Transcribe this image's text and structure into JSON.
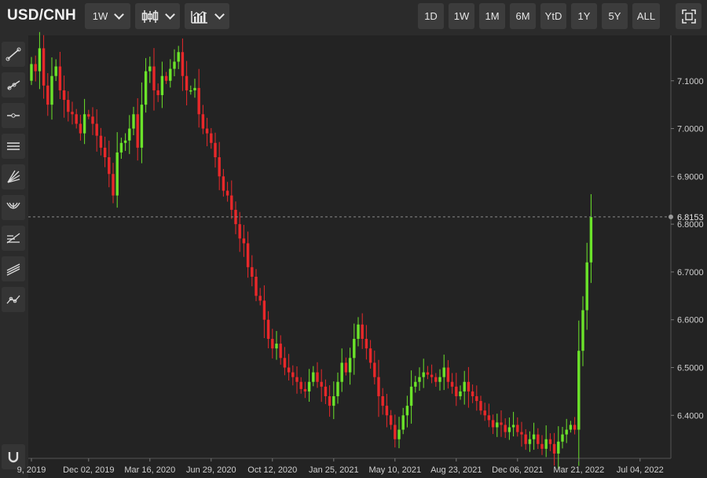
{
  "header": {
    "pair": "USD/CNH",
    "interval_label": "1W",
    "chart_type_icon": "candlestick-icon",
    "indicator_icon": "bar-chart-icon",
    "ranges": [
      "1D",
      "1W",
      "1M",
      "6M",
      "YtD",
      "1Y",
      "5Y",
      "ALL"
    ],
    "fullscreen_icon": "fullscreen-icon"
  },
  "sidebar": {
    "tools": [
      {
        "name": "trend-line-tool",
        "icon": "line-icon"
      },
      {
        "name": "ray-tool",
        "icon": "ray-icon"
      },
      {
        "name": "horizontal-line-tool",
        "icon": "horizontal-line-icon"
      },
      {
        "name": "channel-tool",
        "icon": "channel-icon"
      },
      {
        "name": "fan-tool",
        "icon": "fan-icon"
      },
      {
        "name": "pitchfork-tool",
        "icon": "pitchfork-icon"
      },
      {
        "name": "fibonacci-tool",
        "icon": "fib-icon"
      },
      {
        "name": "parallel-lines-tool",
        "icon": "parallel-icon"
      },
      {
        "name": "path-tool",
        "icon": "path-icon"
      }
    ],
    "magnet_icon": "magnet-icon"
  },
  "colors": {
    "up": "#6be32a",
    "down": "#e8282a",
    "background": "#232323",
    "grid": "#333333",
    "label": "#cfcfcf"
  },
  "chart_data": {
    "type": "candlestick",
    "title": "",
    "last_price": 6.8153,
    "ylim": [
      6.31,
      7.195
    ],
    "y_ticks": [
      "6.4000",
      "6.5000",
      "6.6000",
      "6.7000",
      "6.8000",
      "6.9000",
      "7.0000",
      "7.1000"
    ],
    "x_ticks": [
      {
        "index": 0,
        "label": "9, 2019"
      },
      {
        "index": 14,
        "label": "Dec 02, 2019"
      },
      {
        "index": 29,
        "label": "Mar 16, 2020"
      },
      {
        "index": 44,
        "label": "Jun 29, 2020"
      },
      {
        "index": 59,
        "label": "Oct 12, 2020"
      },
      {
        "index": 74,
        "label": "Jan 25, 2021"
      },
      {
        "index": 89,
        "label": "May 10, 2021"
      },
      {
        "index": 104,
        "label": "Aug 23, 2021"
      },
      {
        "index": 119,
        "label": "Dec 06, 2021"
      },
      {
        "index": 134,
        "label": "Mar 21, 2022"
      },
      {
        "index": 149,
        "label": "Jul 04, 2022"
      }
    ],
    "close": [
      7.135,
      7.12,
      7.168,
      7.09,
      7.05,
      7.11,
      7.13,
      7.08,
      7.06,
      7.035,
      7.03,
      7.01,
      6.99,
      7.03,
      7.025,
      7.01,
      6.985,
      6.96,
      6.94,
      6.905,
      6.86,
      6.95,
      6.97,
      6.975,
      7.0,
      7.03,
      6.96,
      7.05,
      7.12,
      7.13,
      7.08,
      7.07,
      7.11,
      7.1,
      7.125,
      7.14,
      7.16,
      7.11,
      7.08,
      7.08,
      7.085,
      7.03,
      7.0,
      6.99,
      6.97,
      6.94,
      6.9,
      6.87,
      6.86,
      6.83,
      6.8,
      6.77,
      6.76,
      6.71,
      6.69,
      6.65,
      6.64,
      6.6,
      6.56,
      6.54,
      6.55,
      6.52,
      6.5,
      6.49,
      6.48,
      6.47,
      6.455,
      6.45,
      6.47,
      6.49,
      6.47,
      6.46,
      6.44,
      6.42,
      6.44,
      6.47,
      6.51,
      6.49,
      6.52,
      6.56,
      6.59,
      6.56,
      6.54,
      6.51,
      6.48,
      6.44,
      6.42,
      6.4,
      6.38,
      6.35,
      6.37,
      6.4,
      6.42,
      6.46,
      6.47,
      6.48,
      6.49,
      6.485,
      6.48,
      6.47,
      6.48,
      6.5,
      6.47,
      6.46,
      6.44,
      6.45,
      6.47,
      6.45,
      6.44,
      6.43,
      6.41,
      6.4,
      6.39,
      6.375,
      6.385,
      6.38,
      6.365,
      6.375,
      6.38,
      6.365,
      6.36,
      6.34,
      6.35,
      6.36,
      6.34,
      6.33,
      6.35,
      6.34,
      6.32,
      6.345,
      6.36,
      6.37,
      6.38,
      6.37,
      6.535,
      6.62,
      6.72,
      6.815
    ]
  }
}
